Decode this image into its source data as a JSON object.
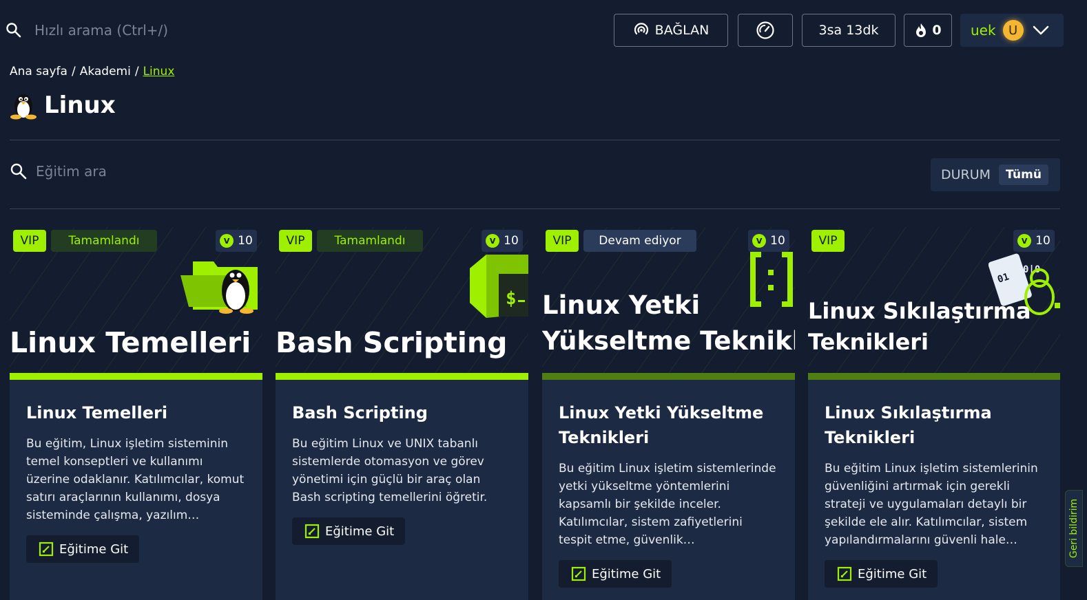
{
  "topbar": {
    "search_placeholder": "Hızlı arama (Ctrl+/)",
    "connect_label": "BAĞLAN",
    "time_label": "3sa 13dk",
    "streak_count": "0",
    "username": "uek",
    "avatar_letter": "U"
  },
  "breadcrumb": {
    "home": "Ana sayfa",
    "sep": "/",
    "academy": "Akademi",
    "current": "Linux"
  },
  "page": {
    "title": "Linux"
  },
  "filters": {
    "search_placeholder": "Eğitim ara",
    "status_label": "DURUM",
    "status_value": "Tümü"
  },
  "cards": [
    {
      "vip": "VIP",
      "status": "Tamamlandı",
      "points": "10",
      "banner_title": "Linux Temelleri",
      "title": "Linux Temelleri",
      "description": "Bu eğitim, Linux işletim sisteminin temel konseptleri ve kullanımı üzerine odaklanır. Katılımcılar, komut satırı araçlarının kullanımı, dosya sisteminde çalışma, yazılım…",
      "button": "Eğitime Git"
    },
    {
      "vip": "VIP",
      "status": "Tamamlandı",
      "points": "10",
      "banner_title": "Bash Scripting",
      "title": "Bash Scripting",
      "description": "Bu eğitim Linux ve UNIX tabanlı sistemlerde otomasyon ve görev yönetimi için güçlü bir araç olan Bash scripting temellerini öğretir.",
      "button": "Eğitime Git"
    },
    {
      "vip": "VIP",
      "status": "Devam ediyor",
      "points": "10",
      "banner_title_line1": "Linux Yetki",
      "banner_title_line2": "Yükseltme Teknikler",
      "title": "Linux Yetki Yükseltme Teknikleri",
      "description": "Bu eğitim Linux işletim sistemlerinde yetki yükseltme yöntemlerini kapsamlı bir şekilde inceler. Katılımcılar, sistem zafiyetlerini tespit etme, güvenlik…",
      "button": "Eğitime Git"
    },
    {
      "vip": "VIP",
      "points": "10",
      "banner_title_line1": "Linux Sıkılaştırma",
      "banner_title_line2": "Teknikleri",
      "title": "Linux Sıkılaştırma Teknikleri",
      "description": "Bu eğitim Linux işletim sistemlerinin güvenliğini artırmak için gerekli strateji ve uygulamaları detaylı bir şekilde ele alır. Katılımcılar, sistem yapılandırmalarını güvenli hale…",
      "button": "Eğitime Git"
    }
  ],
  "feedback": "Geri bildirim",
  "colors": {
    "accent": "#9fef00",
    "background": "#141d2f",
    "panel": "#1d2a44"
  }
}
